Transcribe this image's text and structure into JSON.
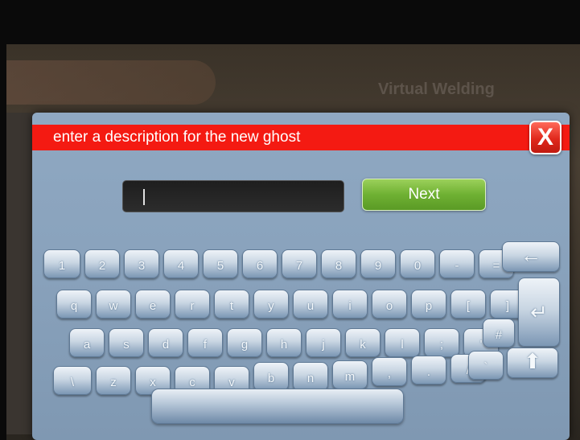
{
  "dialog": {
    "title": "enter a description for the new ghost",
    "close_label": "X",
    "input_value": "",
    "next_label": "Next"
  },
  "background": {
    "title": "Virtual Welding"
  },
  "keyboard": {
    "row1": [
      "1",
      "2",
      "3",
      "4",
      "5",
      "6",
      "7",
      "8",
      "9",
      "0",
      "-",
      "="
    ],
    "backspace": "←",
    "row2": [
      "q",
      "w",
      "e",
      "r",
      "t",
      "y",
      "u",
      "i",
      "o",
      "p",
      "[",
      "]"
    ],
    "enter": "↵",
    "row3": [
      "a",
      "s",
      "d",
      "f",
      "g",
      "h",
      "j",
      "k",
      "l",
      ";",
      "'",
      "#"
    ],
    "row4": [
      "\\",
      "z",
      "x",
      "c",
      "v",
      "b",
      "n",
      "m",
      ",",
      ".",
      "/",
      "`"
    ],
    "shift": "⬆",
    "space": ""
  },
  "colors": {
    "title_bar": "#f41a12",
    "next_button": "#6fb133",
    "dialog_bg": "#8aa3bd"
  }
}
